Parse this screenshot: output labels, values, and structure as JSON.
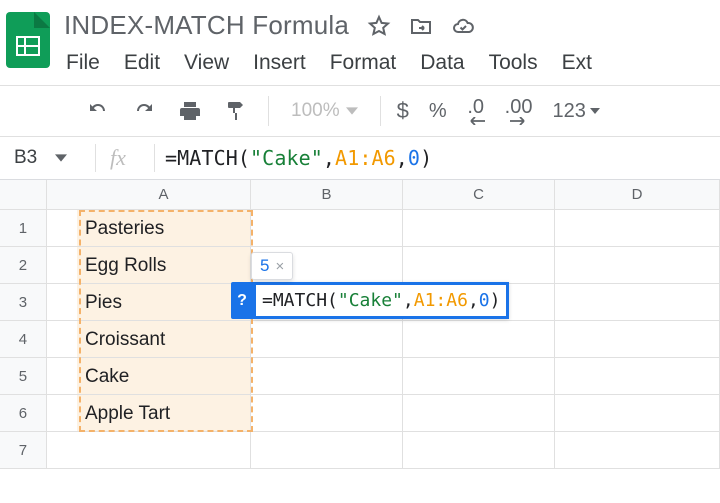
{
  "doc": {
    "title": "INDEX-MATCH Formula"
  },
  "menu": {
    "file": "File",
    "edit": "Edit",
    "view": "View",
    "insert": "Insert",
    "format": "Format",
    "data": "Data",
    "tools": "Tools",
    "ext": "Ext"
  },
  "toolbar": {
    "zoom": "100%",
    "currency": "$",
    "percent": "%",
    "dec_dec": ".0",
    "inc_dec": ".00",
    "num_fmt": "123"
  },
  "name_box": "B3",
  "fx_label": "fx",
  "formula": {
    "prefix": "=",
    "fn": "MATCH",
    "open": "(",
    "str": "\"Cake\"",
    "c1": ",",
    "ref": "A1:A6",
    "c2": ",",
    "num": "0",
    "close": ")"
  },
  "columns": {
    "A": "A",
    "B": "B",
    "C": "C",
    "D": "D"
  },
  "rows": {
    "1": {
      "num": "1",
      "A": "Pasteries"
    },
    "2": {
      "num": "2",
      "A": "Egg Rolls"
    },
    "3": {
      "num": "3",
      "A": "Pies"
    },
    "4": {
      "num": "4",
      "A": "Croissant"
    },
    "5": {
      "num": "5",
      "A": "Cake"
    },
    "6": {
      "num": "6",
      "A": "Apple Tart"
    },
    "7": {
      "num": "7",
      "A": ""
    }
  },
  "editor": {
    "help": "?",
    "result_value": "5",
    "result_close": "×"
  }
}
